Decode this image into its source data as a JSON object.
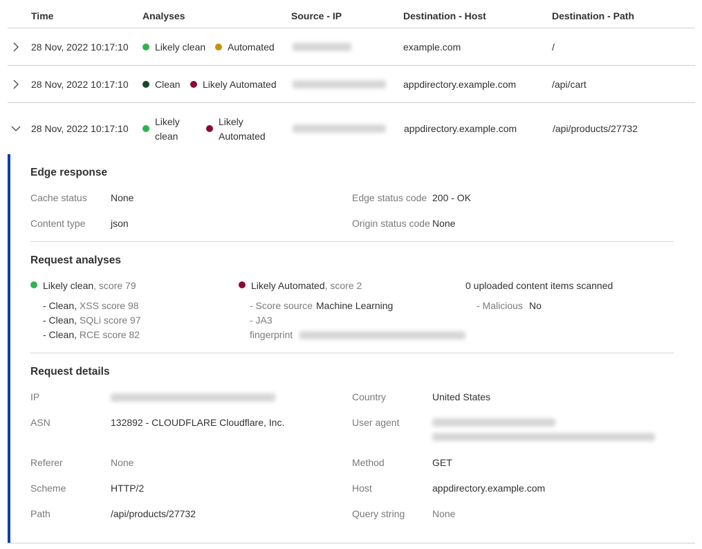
{
  "columns": {
    "time": "Time",
    "analyses": "Analyses",
    "source_ip": "Source - IP",
    "dest_host": "Destination - Host",
    "dest_path": "Destination - Path"
  },
  "colors": {
    "likely_clean": "#2fb24f",
    "automated": "#c79100",
    "clean": "#164a26",
    "likely_automated": "#8b0a32",
    "accent_bar": "#0a3fae"
  },
  "rows": [
    {
      "time": "28 Nov, 2022 10:17:10",
      "analysis_1": "Likely clean",
      "analysis_2": "Automated",
      "host": "example.com",
      "path": "/"
    },
    {
      "time": "28 Nov, 2022 10:17:10",
      "analysis_1": "Clean",
      "analysis_2": "Likely Automated",
      "host": "appdirectory.example.com",
      "path": "/api/cart"
    },
    {
      "time": "28 Nov, 2022 10:17:10",
      "analysis_1a": "Likely",
      "analysis_1b": "clean",
      "analysis_2a": "Likely",
      "analysis_2b": "Automated",
      "host": "appdirectory.example.com",
      "path": "/api/products/27732"
    }
  ],
  "edge_response": {
    "title": "Edge response",
    "cache_status_label": "Cache status",
    "cache_status_value": "None",
    "content_type_label": "Content type",
    "content_type_value": "json",
    "edge_status_label": "Edge status code",
    "edge_status_value": "200 - OK",
    "origin_status_label": "Origin status code",
    "origin_status_value": "None"
  },
  "request_analyses": {
    "title": "Request analyses",
    "clean_title": "Likely clean",
    "clean_score": ", score 79",
    "clean_items": [
      {
        "prefix": "- Clean, ",
        "text": "XSS score 98"
      },
      {
        "prefix": "- Clean, ",
        "text": "SQLi score 97"
      },
      {
        "prefix": "- Clean, ",
        "text": "RCE score 82"
      }
    ],
    "auto_title": "Likely Automated",
    "auto_score": ", score 2",
    "score_source_label": "- Score source",
    "score_source_value": "Machine Learning",
    "ja3_label_1": "- JA3",
    "ja3_label_2": "fingerprint",
    "uploaded_title": "0 uploaded content items scanned",
    "malicious_label": "- Malicious",
    "malicious_value": "No"
  },
  "request_details": {
    "title": "Request details",
    "ip_label": "IP",
    "asn_label": "ASN",
    "asn_value": "132892 - CLOUDFLARE Cloudflare, Inc.",
    "referer_label": "Referer",
    "referer_value": "None",
    "scheme_label": "Scheme",
    "scheme_value": "HTTP/2",
    "path_label": "Path",
    "path_value": "/api/products/27732",
    "country_label": "Country",
    "country_value": "United States",
    "user_agent_label": "User agent",
    "method_label": "Method",
    "method_value": "GET",
    "host_label": "Host",
    "host_value": "appdirectory.example.com",
    "query_label": "Query string",
    "query_value": "None"
  }
}
